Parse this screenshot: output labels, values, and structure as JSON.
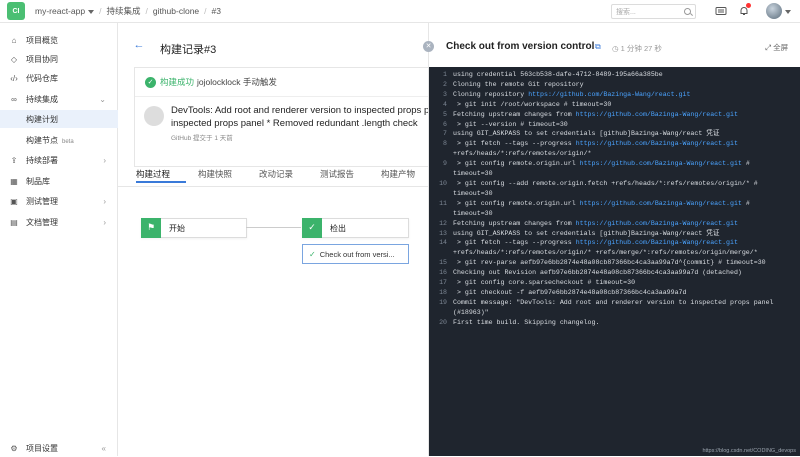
{
  "topbar": {
    "logo_text": "CI",
    "project": "my-react-app",
    "crumbs": [
      "持续集成",
      "github-clone",
      "#3"
    ],
    "search_placeholder": "搜索..."
  },
  "sidebar": {
    "items": [
      {
        "label": "项目概览",
        "icon": "home-icon",
        "arrow": ""
      },
      {
        "label": "项目协同",
        "icon": "cube-icon",
        "arrow": ""
      },
      {
        "label": "代码仓库",
        "icon": "code-icon",
        "arrow": ""
      },
      {
        "label": "持续集成",
        "icon": "infinity-icon",
        "arrow": "⌄"
      },
      {
        "label": "构建计划",
        "icon": "",
        "arrow": ""
      },
      {
        "label": "构建节点",
        "icon": "",
        "arrow": ""
      },
      {
        "label": "持续部署",
        "icon": "rocket-icon",
        "arrow": "›"
      },
      {
        "label": "制品库",
        "icon": "box-icon",
        "arrow": ""
      },
      {
        "label": "测试管理",
        "icon": "test-icon",
        "arrow": "›"
      },
      {
        "label": "文档管理",
        "icon": "doc-icon",
        "arrow": "›"
      }
    ],
    "beta": "beta",
    "settings": "项目设置",
    "collapse": "«"
  },
  "main": {
    "title": "构建记录#3",
    "status": "构建成功",
    "trigger": "jojolocklock 手动触发",
    "commit_line1": "DevTools: Add root and renderer version to inspected props panel",
    "commit_line2": "inspected props panel * Removed redundant .length check",
    "commit_meta": "GitHub 提交于 1 天前",
    "tabs": [
      "构建过程",
      "构建快照",
      "改动记录",
      "测试报告",
      "构建产物"
    ],
    "stages": [
      {
        "name": "开始",
        "icon": "flag-icon"
      },
      {
        "name": "检出",
        "icon": "check-icon"
      }
    ],
    "step": "Check out from versi..."
  },
  "drawer": {
    "title": "Check out from version control",
    "duration": "1 分钟 27 秒",
    "fullscreen": "全屏",
    "watermark": "https://blog.csdn.net/CODING_devops",
    "log": [
      {
        "no": "1",
        "text": "using credential 563cb538-dafe-4712-8489-195a66a385be",
        "url": ""
      },
      {
        "no": "2",
        "text": "Cloning the remote Git repository",
        "url": ""
      },
      {
        "no": "3",
        "text": "Cloning repository ",
        "url": "https://github.com/Bazinga-Wang/react.git"
      },
      {
        "no": "4",
        "text": " > git init /root/workspace # timeout=30",
        "url": ""
      },
      {
        "no": "5",
        "text": "Fetching upstream changes from ",
        "url": "https://github.com/Bazinga-Wang/react.git"
      },
      {
        "no": "6",
        "text": " > git --version # timeout=30",
        "url": ""
      },
      {
        "no": "7",
        "text": "using GIT_ASKPASS to set credentials [github]Bazinga-Wang/react 凭证",
        "url": ""
      },
      {
        "no": "8",
        "text": " > git fetch --tags --progress ",
        "url": "https://github.com/Bazinga-Wang/react.git",
        "tail": "\n+refs/heads/*:refs/remotes/origin/*"
      },
      {
        "no": "9",
        "text": " > git config remote.origin.url ",
        "url": "https://github.com/Bazinga-Wang/react.git",
        "tail": " # timeout=30"
      },
      {
        "no": "10",
        "text": " > git config --add remote.origin.fetch +refs/heads/*:refs/remotes/origin/* #\ntimeout=30",
        "url": ""
      },
      {
        "no": "11",
        "text": " > git config remote.origin.url ",
        "url": "https://github.com/Bazinga-Wang/react.git",
        "tail": " # timeout=30"
      },
      {
        "no": "12",
        "text": "Fetching upstream changes from ",
        "url": "https://github.com/Bazinga-Wang/react.git"
      },
      {
        "no": "13",
        "text": "using GIT_ASKPASS to set credentials [github]Bazinga-Wang/react 凭证",
        "url": ""
      },
      {
        "no": "14",
        "text": " > git fetch --tags --progress ",
        "url": "https://github.com/Bazinga-Wang/react.git",
        "tail": "\n+refs/heads/*:refs/remotes/origin/* +refs/merge/*:refs/remotes/origin/merge/*"
      },
      {
        "no": "15",
        "text": " > git rev-parse aefb97e6bb2874e48a08cb87366bc4ca3aa99a7d^{commit} # timeout=30",
        "url": ""
      },
      {
        "no": "16",
        "text": "Checking out Revision aefb97e6bb2874e48a08cb87366bc4ca3aa99a7d (detached)",
        "url": ""
      },
      {
        "no": "17",
        "text": " > git config core.sparsecheckout # timeout=30",
        "url": ""
      },
      {
        "no": "18",
        "text": " > git checkout -f aefb97e6bb2874e48a08cb87366bc4ca3aa99a7d",
        "url": ""
      },
      {
        "no": "19",
        "text": "Commit message: \"DevTools: Add root and renderer version to inspected props panel\n(#18963)\"",
        "url": ""
      },
      {
        "no": "20",
        "text": "First time build. Skipping changelog.",
        "url": ""
      }
    ]
  },
  "colors": {
    "accent": "#3a7ad9",
    "success": "#3bb36b",
    "log_bg": "#1f252e",
    "link": "#4aa3ff"
  }
}
